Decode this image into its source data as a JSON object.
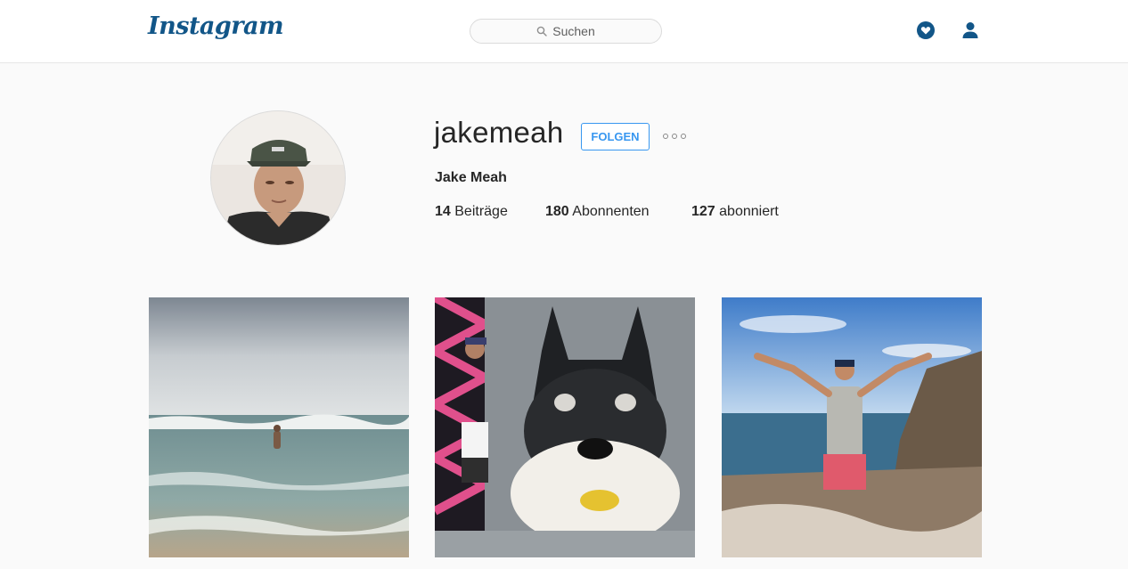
{
  "header": {
    "logo_text": "Instagram",
    "search_placeholder": "Suchen",
    "icons": [
      "search-icon",
      "activity-heart-icon",
      "profile-icon"
    ]
  },
  "profile": {
    "username": "jakemeah",
    "follow_label": "FOLGEN",
    "full_name": "Jake Meah",
    "stats": {
      "posts_count": "14",
      "posts_label": "Beiträge",
      "followers_count": "180",
      "followers_label": "Abonnenten",
      "following_count": "127",
      "following_label": "abonniert"
    }
  },
  "colors": {
    "brand": "#125688",
    "follow_blue": "#3897f0",
    "background": "#fafafa"
  },
  "posts": [
    {
      "subject": "beach-wading-photo"
    },
    {
      "subject": "batman-pug-mural-photo"
    },
    {
      "subject": "rocky-coast-arms-raised-photo"
    }
  ]
}
